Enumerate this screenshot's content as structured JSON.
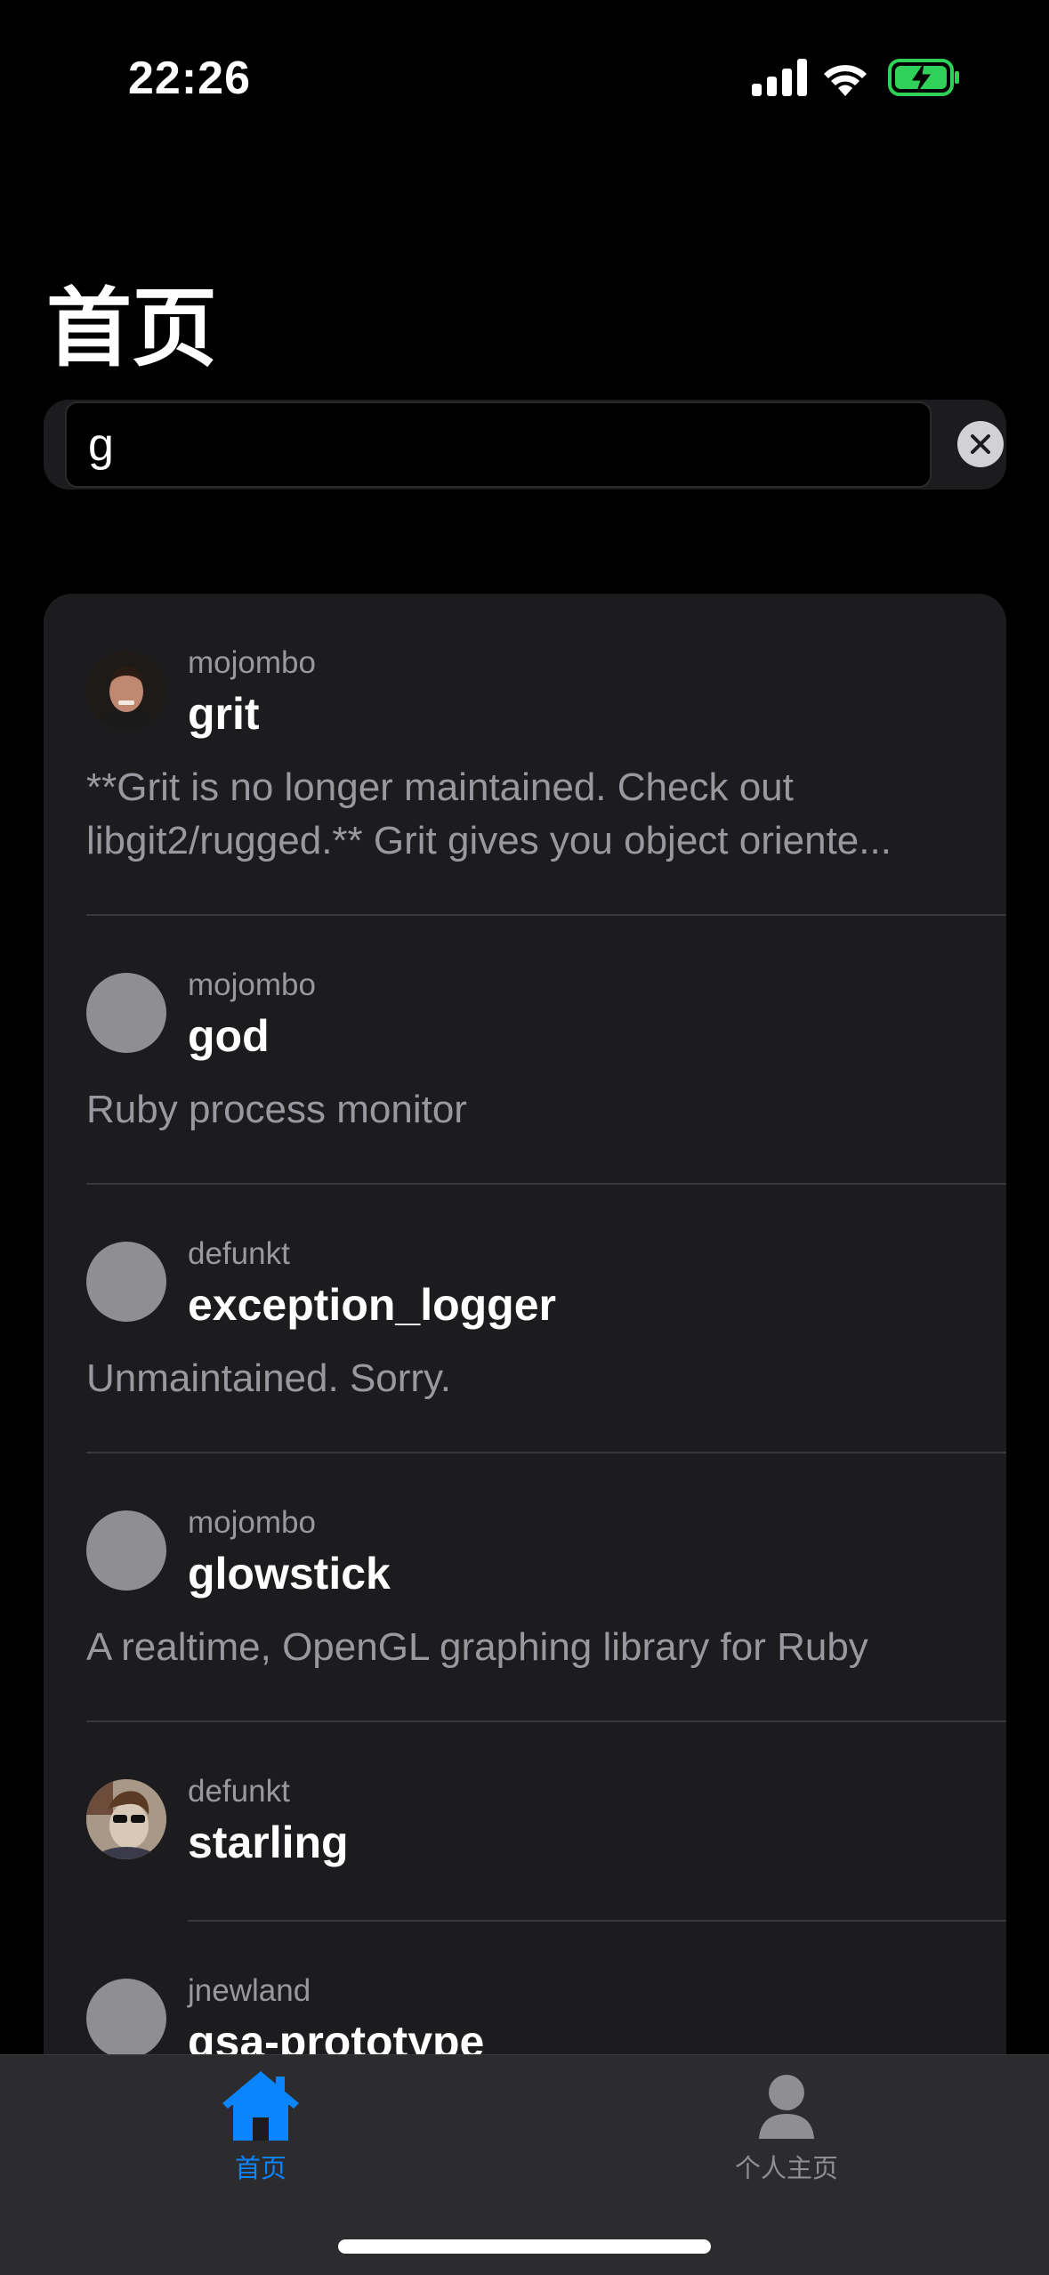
{
  "status_bar": {
    "time": "22:26"
  },
  "page": {
    "title": "首页"
  },
  "search": {
    "value": "g",
    "placeholder": ""
  },
  "repos": [
    {
      "owner": "mojombo",
      "name": "grit",
      "description": "**Grit is no longer maintained. Check out libgit2/rugged.** Grit gives you object oriente..."
    },
    {
      "owner": "mojombo",
      "name": "god",
      "description": "Ruby process monitor"
    },
    {
      "owner": "defunkt",
      "name": "exception_logger",
      "description": "Unmaintained. Sorry."
    },
    {
      "owner": "mojombo",
      "name": "glowstick",
      "description": "A realtime, OpenGL graphing library for Ruby"
    },
    {
      "owner": "defunkt",
      "name": "starling",
      "description": ""
    },
    {
      "owner": "jnewland",
      "name": "gsa-prototype",
      "description": ""
    }
  ],
  "tabs": [
    {
      "label": "首页",
      "icon": "house-icon",
      "active": true
    },
    {
      "label": "个人主页",
      "icon": "person-icon",
      "active": false
    }
  ],
  "colors": {
    "accent": "#0a84ff",
    "battery": "#30d158",
    "secondary_text": "#98989f",
    "inactive_tab": "#8e8e93"
  }
}
